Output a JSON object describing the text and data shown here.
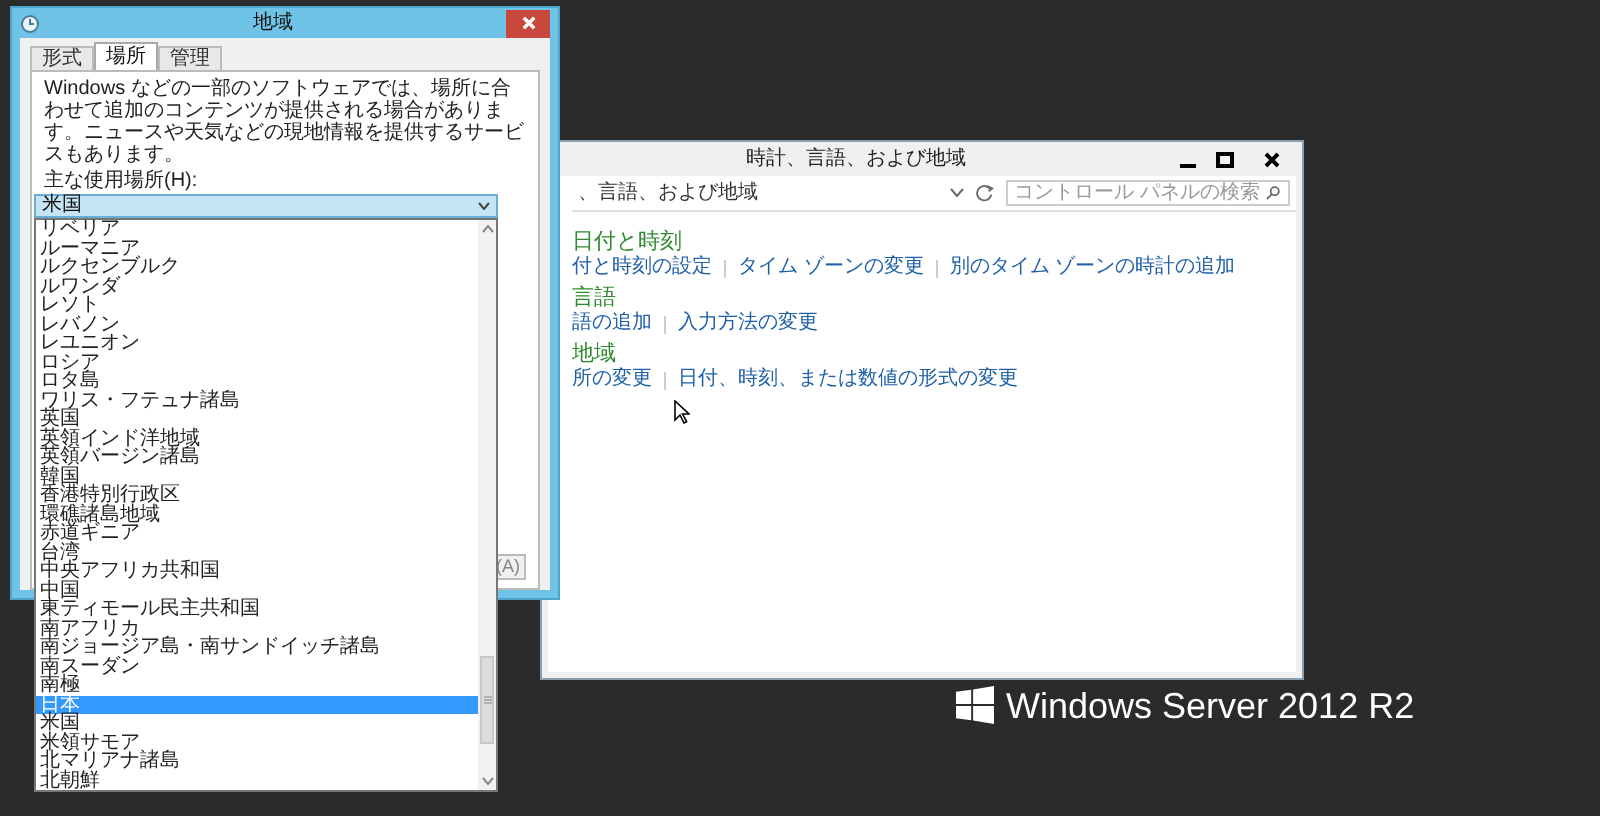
{
  "control_panel": {
    "title": "時計、言語、および地域",
    "address": "、言語、および地域",
    "search": {
      "placeholder": "コントロール パネルの検索"
    },
    "sections": [
      {
        "heading": "日付と時刻",
        "links": [
          "付と時刻の設定",
          "タイム ゾーンの変更",
          "別のタイム ゾーンの時計の追加"
        ]
      },
      {
        "heading": "言語",
        "links": [
          "語の追加",
          "入力方法の変更"
        ]
      },
      {
        "heading": "地域",
        "links": [
          "所の変更",
          "日付、時刻、または数値の形式の変更"
        ]
      }
    ]
  },
  "region_dialog": {
    "title": "地域",
    "tabs": [
      {
        "label": "形式",
        "selected": false
      },
      {
        "label": "場所",
        "selected": true
      },
      {
        "label": "管理",
        "selected": false
      }
    ],
    "description": "Windows などの一部のソフトウェアでは、場所に合わせて追加のコンテンツが提供される場合があります。ニュースや天気などの現地情報を提供するサービスもあります。",
    "location_label": "主な使用場所(H):",
    "location_value": "米国",
    "apply_button": "(A)",
    "dropdown_items": [
      {
        "label": "リベリア",
        "selected": false
      },
      {
        "label": "ルーマニア",
        "selected": false
      },
      {
        "label": "ルクセンブルク",
        "selected": false
      },
      {
        "label": "ルワンダ",
        "selected": false
      },
      {
        "label": "レソト",
        "selected": false
      },
      {
        "label": "レバノン",
        "selected": false
      },
      {
        "label": "レユニオン",
        "selected": false
      },
      {
        "label": "ロシア",
        "selected": false
      },
      {
        "label": "ロタ島",
        "selected": false
      },
      {
        "label": "ワリス・フテュナ諸島",
        "selected": false
      },
      {
        "label": "英国",
        "selected": false
      },
      {
        "label": "英領インド洋地域",
        "selected": false
      },
      {
        "label": "英領バージン諸島",
        "selected": false
      },
      {
        "label": "韓国",
        "selected": false
      },
      {
        "label": "香港特別行政区",
        "selected": false
      },
      {
        "label": "環礁諸島地域",
        "selected": false
      },
      {
        "label": "赤道ギニア",
        "selected": false
      },
      {
        "label": "台湾",
        "selected": false
      },
      {
        "label": "中央アフリカ共和国",
        "selected": false
      },
      {
        "label": "中国",
        "selected": false
      },
      {
        "label": "東ティモール民主共和国",
        "selected": false
      },
      {
        "label": "南アフリカ",
        "selected": false
      },
      {
        "label": "南ジョージア島・南サンドイッチ諸島",
        "selected": false
      },
      {
        "label": "南スーダン",
        "selected": false
      },
      {
        "label": "南極",
        "selected": false
      },
      {
        "label": "日本",
        "selected": true
      },
      {
        "label": "米国",
        "selected": false
      },
      {
        "label": "米領サモア",
        "selected": false
      },
      {
        "label": "北マリアナ諸島",
        "selected": false
      },
      {
        "label": "北朝鮮",
        "selected": false
      }
    ]
  },
  "branding": {
    "text": "Windows Server 2012 R2"
  }
}
